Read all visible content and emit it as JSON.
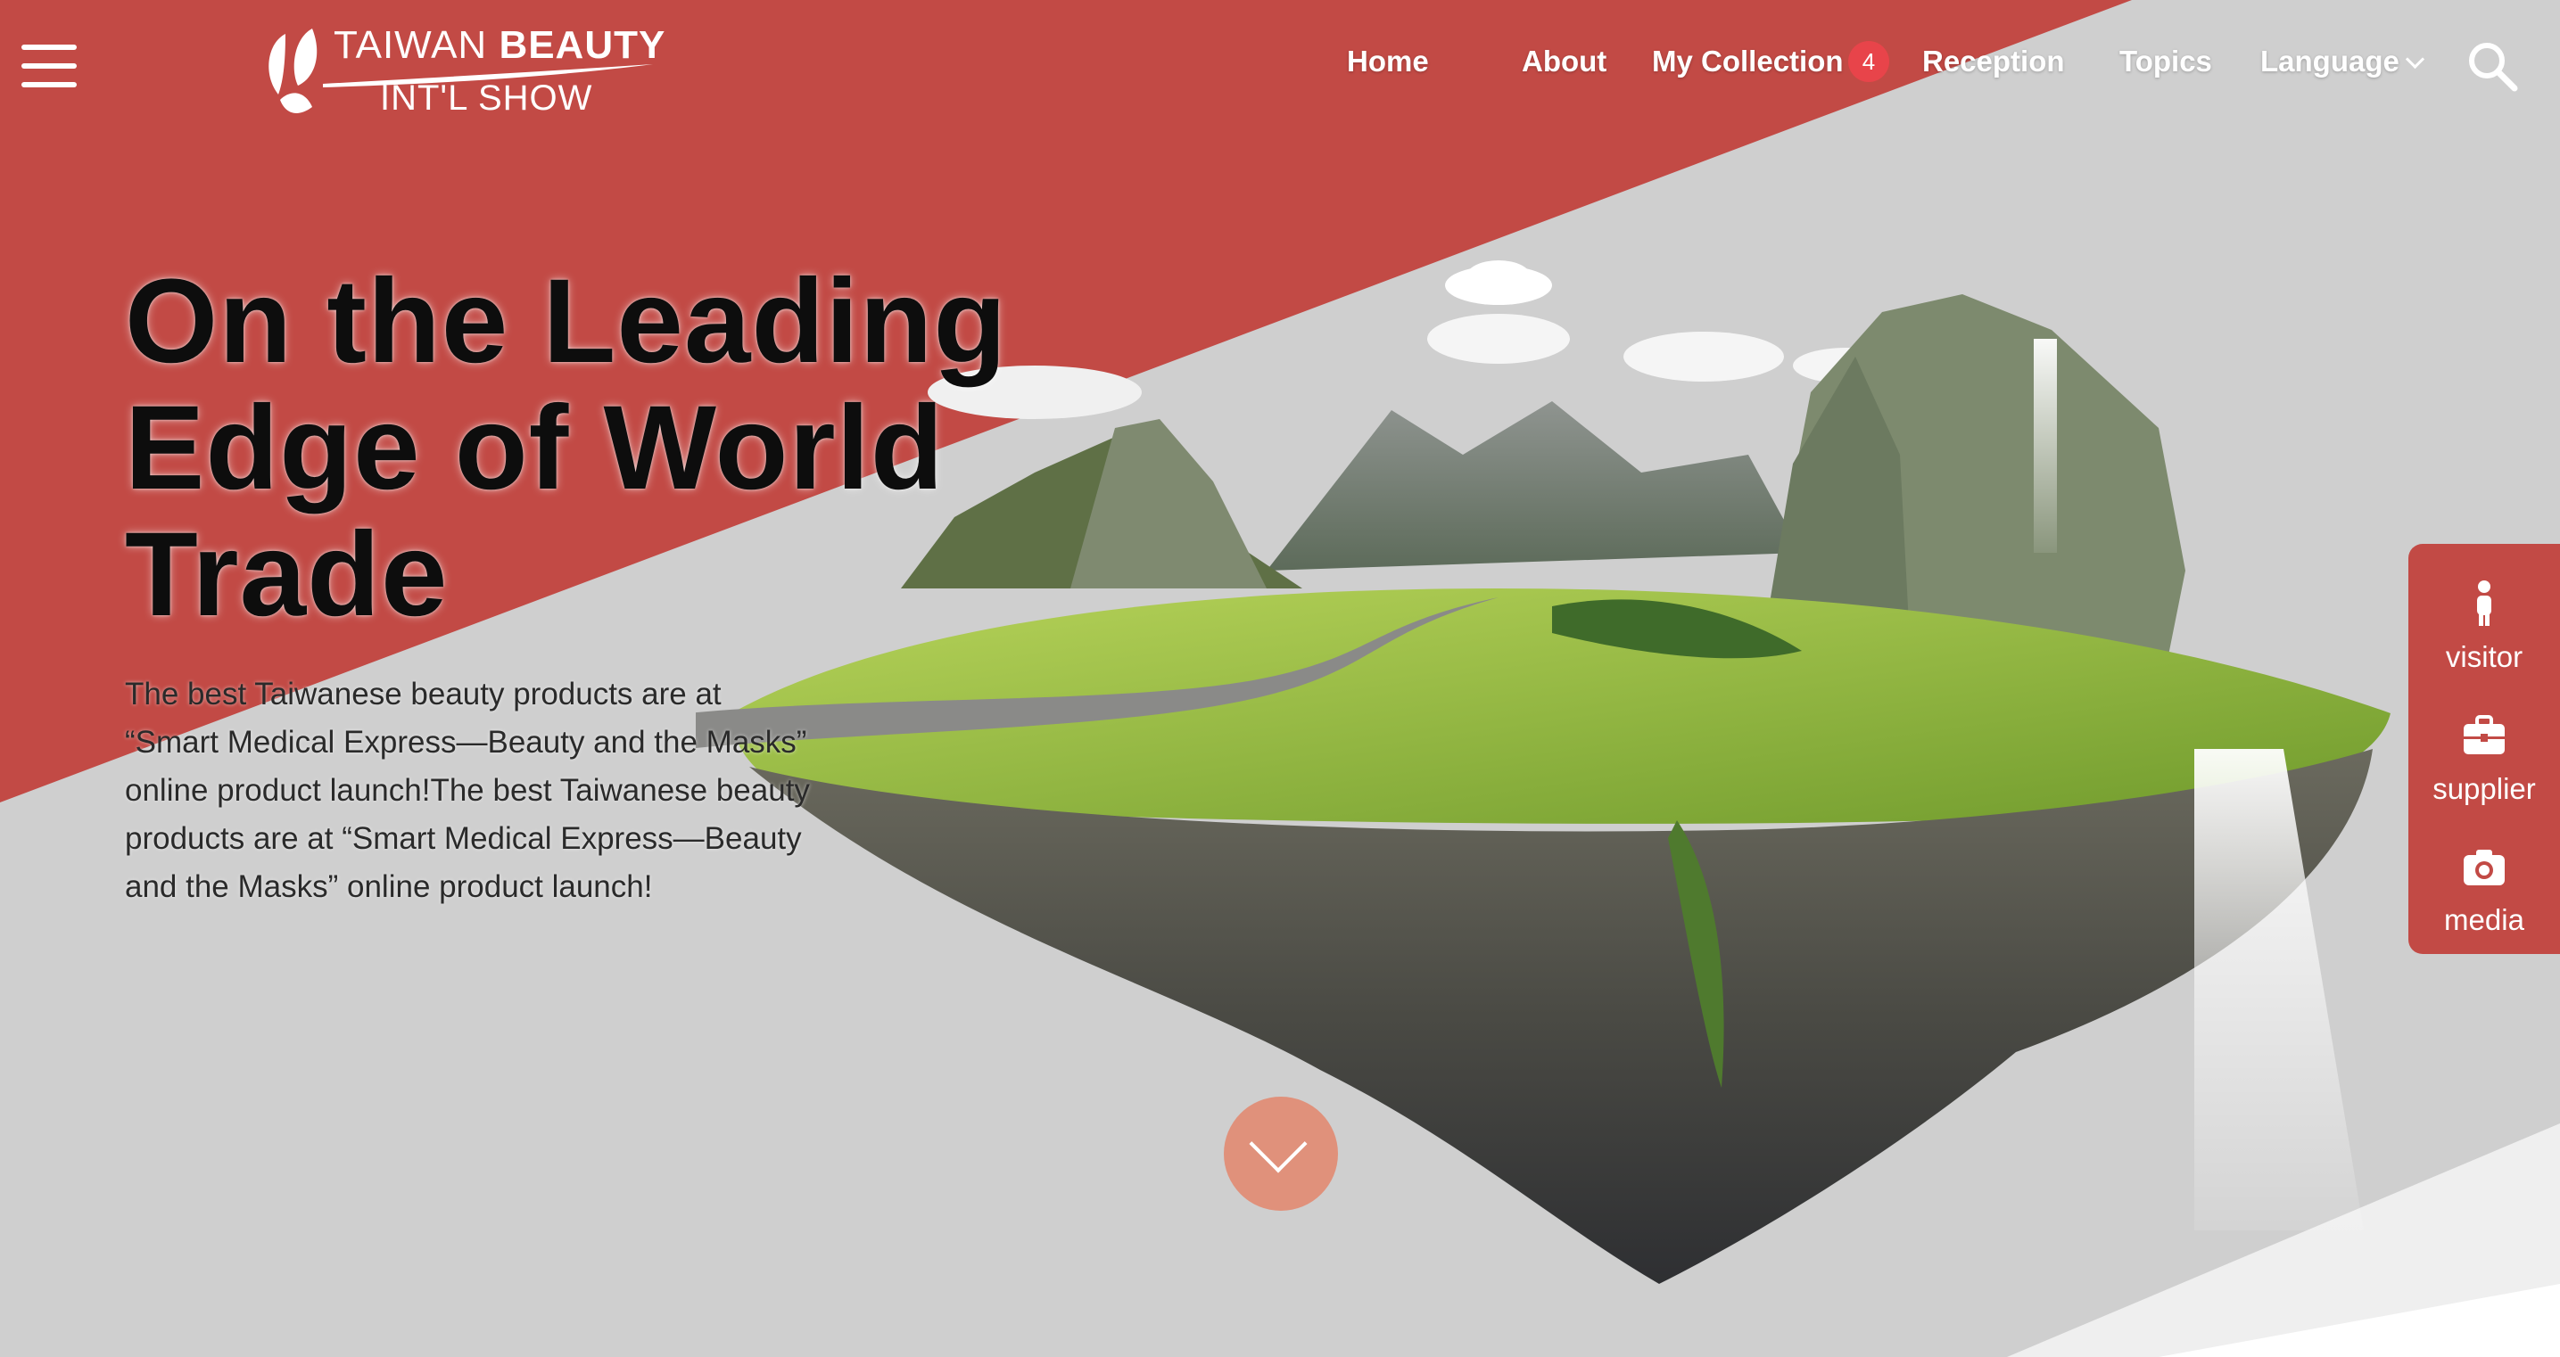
{
  "colors": {
    "brand_red": "#c24a45",
    "background_gray": "#cfcfcf",
    "badge_red": "#e8444a",
    "scroll_button": "#e0917b"
  },
  "header": {
    "logo": {
      "line1_regular": "TAIWAN",
      "line1_bold": "BEAUTY",
      "line2": "INT'L SHOW",
      "icon": "butterfly-logo-icon"
    },
    "menu_icon": "hamburger-menu-icon",
    "nav": [
      {
        "label": "Home"
      },
      {
        "label": "About"
      },
      {
        "label": "My Collection"
      },
      {
        "label": "Reception"
      },
      {
        "label": "Topics"
      },
      {
        "label": "Language"
      }
    ],
    "collection_count": "4",
    "search_icon": "search-icon"
  },
  "hero": {
    "title": "On the Leading Edge of World Trade",
    "description": "The best Taiwanese beauty products are at “Smart Medical Express—Beauty and the Masks” online product launch!The best Taiwanese beauty products are at “Smart Medical Express—Beauty and the Masks” online product launch!",
    "image": "floating-island-landscape",
    "scroll_icon": "chevron-down-icon"
  },
  "side_panel": [
    {
      "label": "visitor",
      "icon": "person-icon"
    },
    {
      "label": "supplier",
      "icon": "briefcase-icon"
    },
    {
      "label": "media",
      "icon": "camera-icon"
    }
  ]
}
